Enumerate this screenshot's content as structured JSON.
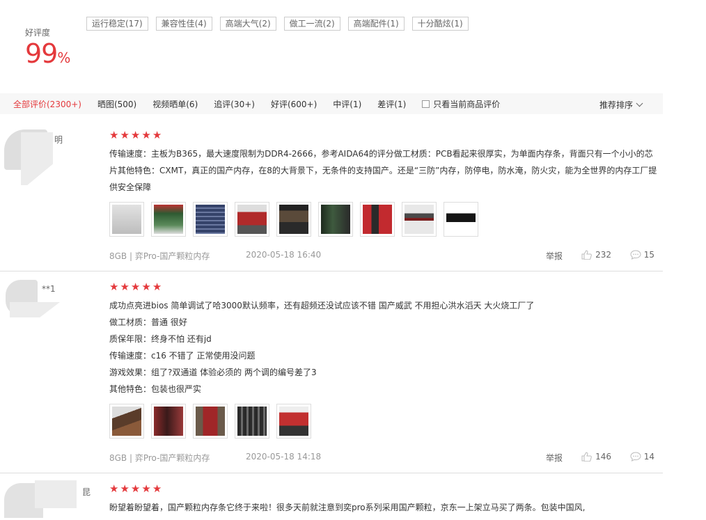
{
  "rating": {
    "label": "好评度",
    "value": "99",
    "unit": "%"
  },
  "tags": [
    "运行稳定(17)",
    "兼容性佳(4)",
    "高端大气(2)",
    "做工一流(2)",
    "高端配件(1)",
    "十分酷炫(1)"
  ],
  "filters": {
    "items": [
      "全部评价(2300+)",
      "晒图(500)",
      "视频晒单(6)",
      "追评(30+)",
      "好评(600+)",
      "中评(1)",
      "差评(1)"
    ],
    "only_current": "只看当前商品评价",
    "sort": "推荐排序"
  },
  "reviews": [
    {
      "username": "明",
      "stars": 5,
      "content": [
        "传输速度：主板为B365，最大速度限制为DDR4-2666，参考AIDA64的评分做工材质：PCB看起来很厚实，为单面内存条，背面只有一个小小的芯片其他特色：CXMT，真正的国产内存，在8的大背景下，无条件的支持国产。还是“三防”内存，防停电，防水淹，防火灾，能为全世界的内存工厂提供安全保障"
      ],
      "photo_colors": [
        "#cfcfcf",
        "#4a7a4a",
        "#3c4a66",
        "#b02a2a",
        "#2f2f2f",
        "#3a4a3a",
        "#b8262c",
        "#444444",
        "#1c1c1c"
      ],
      "product": "8GB | 弈Pro-国产颗粒内存",
      "date": "2020-05-18 16:40",
      "report": "举报",
      "likes": "232",
      "comments": "15"
    },
    {
      "username": "**1",
      "stars": 5,
      "content": [
        "成功点亮进bios 简单调试了哈3000默认频率，还有超频还没试应该不错 国产威武 不用担心洪水滔天 大火烧工厂了",
        "做工材质：普通 很好",
        "质保年限：终身不怕 还有jd",
        "传输速度：c16 不错了 正常使用没问题",
        "游戏效果：组了?双通道 体验必须的 两个调的编号差了3",
        "其他特色：包装也很严实"
      ],
      "photo_colors": [
        "#5a3c2a",
        "#8a2a2a",
        "#a02628",
        "#3a3a3a",
        "#c23030"
      ],
      "product": "8GB | 弈Pro-国产颗粒内存",
      "date": "2020-05-18 14:18",
      "report": "举报",
      "likes": "146",
      "comments": "14"
    },
    {
      "username": "昆",
      "stars": 5,
      "content": [
        "盼望着盼望着，国产颗粒内存条它终于来啦！很多天前就注意到奕pro系列采用国产颗粒，京东一上架立马买了两条。包装中国风,"
      ]
    }
  ]
}
